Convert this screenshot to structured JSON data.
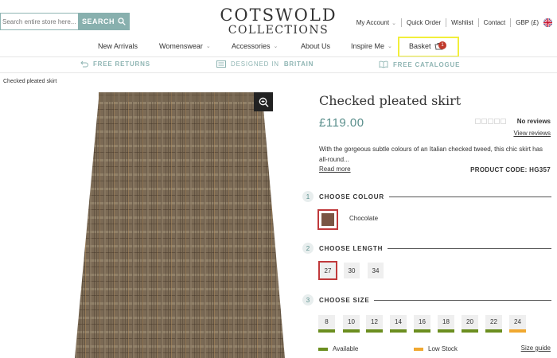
{
  "search": {
    "placeholder": "Search entire store here...",
    "button_label": "SEARCH"
  },
  "logo": {
    "line1": "COTSWOLD",
    "line2": "COLLECTIONS"
  },
  "utility_nav": {
    "account": "My Account",
    "quick_order": "Quick Order",
    "wishlist": "Wishlist",
    "contact": "Contact",
    "currency": "GBP (£)"
  },
  "main_nav": {
    "items": [
      "New Arrivals",
      "Womenswear",
      "Accessories",
      "About Us",
      "Inspire Me"
    ],
    "basket_label": "Basket",
    "basket_count": "1"
  },
  "usp": {
    "returns": "FREE RETURNS",
    "designed_prefix": "DESIGNED IN",
    "designed_place": "BRITAIN",
    "catalogue": "FREE CATALOGUE"
  },
  "breadcrumb": "Checked pleated skirt",
  "product": {
    "title": "Checked pleated skirt",
    "price": "£119.00",
    "reviews_count": "No reviews",
    "view_reviews": "View reviews",
    "description": "With the gorgeous subtle colours of an Italian checked tweed, this chic skirt has all-round...",
    "read_more": "Read more",
    "product_code": "PRODUCT CODE: HG357"
  },
  "options": {
    "colour": {
      "step": "1",
      "label": "CHOOSE COLOUR",
      "selected": "Chocolate",
      "swatch_color": "#7a5544"
    },
    "length": {
      "step": "2",
      "label": "CHOOSE LENGTH",
      "values": [
        "27",
        "30",
        "34"
      ],
      "selected": "27"
    },
    "size": {
      "step": "3",
      "label": "CHOOSE SIZE",
      "values": [
        "8",
        "10",
        "12",
        "14",
        "16",
        "18",
        "20",
        "22",
        "24"
      ],
      "stock": [
        "available",
        "available",
        "available",
        "available",
        "available",
        "available",
        "available",
        "available",
        "low"
      ]
    }
  },
  "legend": {
    "available": "Available",
    "low_stock": "Low Stock",
    "size_guide": "Size guide"
  },
  "colors": {
    "accent": "#88b0ae",
    "price": "#5a8f8c",
    "selected_border": "#c0393b",
    "available": "#6b8e1f",
    "low_stock": "#f0a830"
  }
}
